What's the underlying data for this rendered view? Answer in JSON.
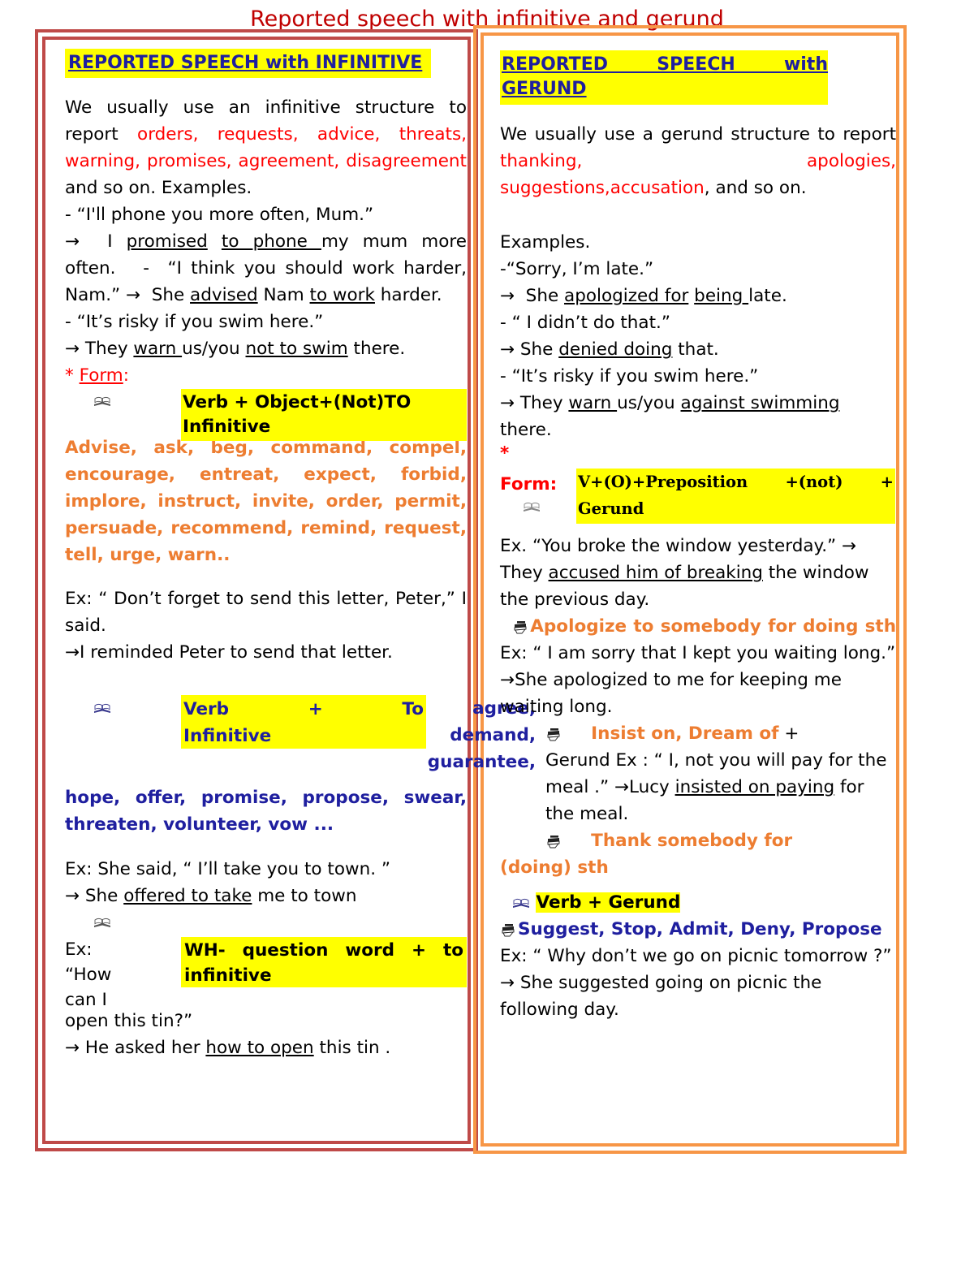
{
  "title": "Reported speech with infinitive and gerund",
  "colors": {
    "title": "#c00000",
    "left_frame": "#bf4a48",
    "right_frame": "#f79646",
    "highlight": "#ffff00",
    "red_text": "#ff0000",
    "orange_text": "#ed7d31",
    "blue_text": "#1f1f9f"
  },
  "left_column": {
    "heading": "REPORTED SPEECH with INFINITIVE",
    "intro": {
      "lead": "We usually use an infinitive structure to report ",
      "red_terms": "orders, requests, advice, threats, warning, promises, agreement, disagreement",
      "tail": " and so on. Examples."
    },
    "examples_1": [
      "- “I'll phone you more often, Mum.”",
      "→  I promised to phone my mum more often.   -  “I think you should work harder, Nam.” →  She advised Nam to work harder.",
      "- “It’s risky if you swim here.”",
      "→ They warn us/you not to swim there."
    ],
    "form_label": "* Form:",
    "rule_1": {
      "icon": "open-book-icon",
      "text": "Verb + Object+(Not)TO Infinitive",
      "verbs": "Advise, ask, beg, command, compel, encourage, entreat, expect, forbid, implore, instruct, invite, order, permit, persuade, recommend, remind, request, tell, urge, warn..",
      "example_q": "Ex: “ Don’t forget to send  this  letter, Peter,” I said.",
      "example_a": "→I reminded Peter to send that letter."
    },
    "rule_2": {
      "icon": "open-book-icon",
      "box_line1": "Verb + To",
      "box_line2": "Infinitive",
      "overlap_verbs": [
        "agree,",
        "demand,",
        "guarantee,"
      ],
      "verbs_rest": "hope, offer, promise, propose, swear, threaten, volunteer, vow ...",
      "example_q": "Ex: She said, “ I’ll take you to town. ”",
      "example_a": "→ She offered to take me to town"
    },
    "rule_3": {
      "icon": "open-book-icon",
      "box_line1": "WH- question word + to",
      "box_line2": "infinitive",
      "left_words": [
        "Ex:",
        "“How",
        "can I"
      ],
      "example_q_tail": "open this tin?”",
      "example_a": "→ He asked her how to open this tin ."
    }
  },
  "right_column": {
    "heading_line1": "REPORTED SPEECH with",
    "heading_line2": "GERUND",
    "intro": {
      "lead": "We usually use a gerund structure to report ",
      "red_terms_a": "thanking,",
      "red_terms_b": "apologies,",
      "red_terms_c": "suggestions,accusation",
      "tail": ", and so on."
    },
    "examples_label": "Examples.",
    "examples_1": [
      "  -“Sorry, I’m late.”",
      "→  She apologized for being late.",
      "- “ I didn’t do that.”",
      "→ She denied doing that.",
      "- “It’s risky if you swim here.”",
      "→ They warn us/you against swimming there."
    ],
    "asterisk": "*",
    "form_label": "Form:",
    "form_box_line1": "V+(O)+Preposition +(not) +",
    "form_box_line2": "Gerund",
    "form_icon": "open-book-icon",
    "example_break": {
      "q": "Ex. “You broke the window yesterday.” → They accused him of breaking the window the previous day."
    },
    "rule_apologize": {
      "icon": "stacked-books-icon",
      "orange_head": "Apologize to somebody for doing sth",
      "example_q": " Ex: “ I am sorry that I kept you waiting long.”",
      "example_a": "→She apologized to me for keeping me waiting long."
    },
    "rule_insist": {
      "icon": "stacked-books-icon",
      "orange_head": "Insist on, Dream of",
      "example_q": "+ Gerund  Ex : “ I, not you will pay for the meal .”  →Lucy insisted on paying for the meal."
    },
    "rule_thank": {
      "icon": "stacked-books-icon",
      "orange_head_line1": "Thank somebody for",
      "orange_head_line2": "(doing) sth"
    },
    "rule_verb_gerund": {
      "icon": "open-book-icon",
      "label": "Verb + Gerund",
      "books_icon": "stacked-books-icon",
      "blue_verbs": "Suggest, Stop, Admit, Deny, Propose",
      "example_q": "Ex: “ Why don’t we go on picnic tomorrow ?”",
      "example_a": "→ She suggested going on picnic the following day."
    }
  }
}
